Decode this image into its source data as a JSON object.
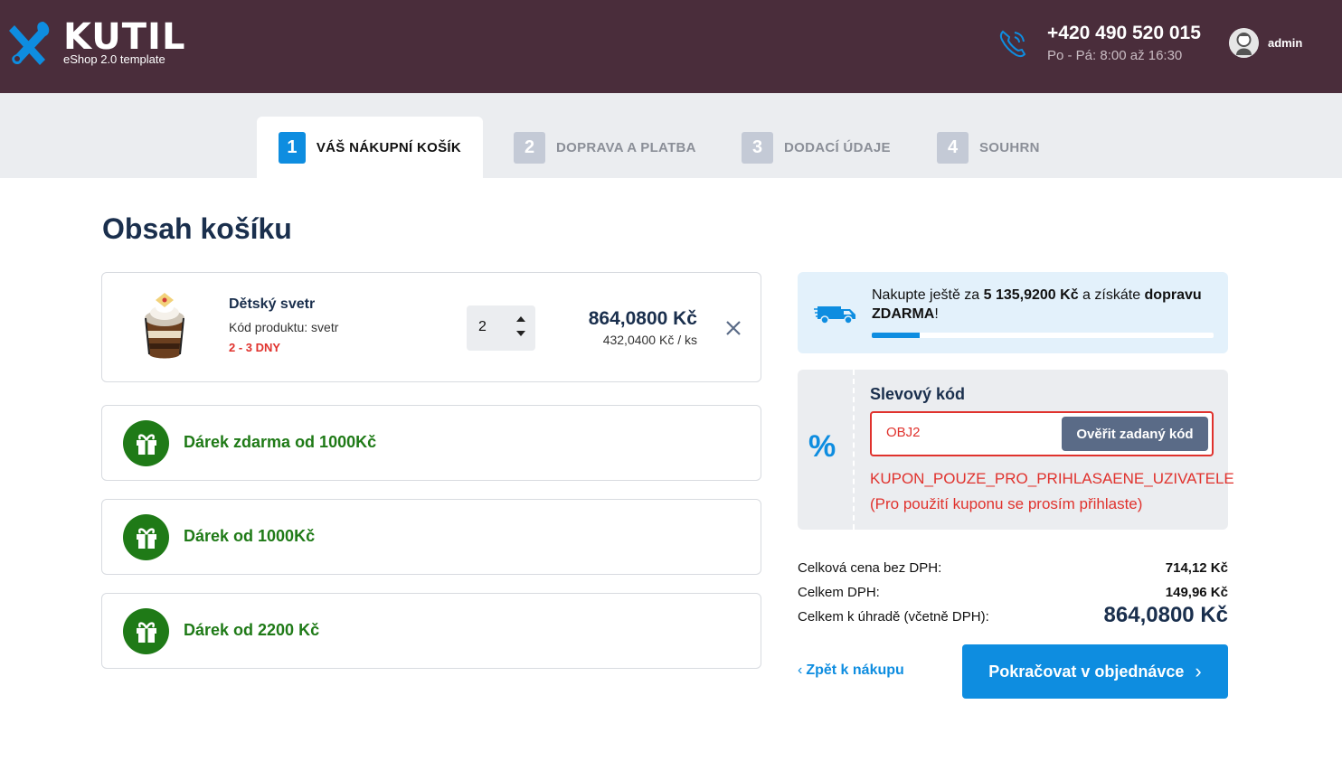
{
  "header": {
    "logo_name": "KUTIL",
    "logo_sub": "eShop 2.0 template",
    "phone": "+420 490 520 015",
    "hours": "Po - Pá: 8:00 až 16:30",
    "user": "admin"
  },
  "steps": [
    {
      "num": "1",
      "label": "VÁŠ NÁKUPNÍ KOŠÍK"
    },
    {
      "num": "2",
      "label": "DOPRAVA A PLATBA"
    },
    {
      "num": "3",
      "label": "DODACÍ ÚDAJE"
    },
    {
      "num": "4",
      "label": "SOUHRN"
    }
  ],
  "page_title": "Obsah košíku",
  "product": {
    "name": "Dětský svetr",
    "code": "Kód produktu: svetr",
    "stock": "2 - 3 DNY",
    "quantity": "2",
    "price_total": "864,0800 Kč",
    "price_unit": "432,0400 Kč / ks"
  },
  "gifts": [
    "Dárek zdarma od 1000Kč",
    "Dárek od 1000Kč",
    "Dárek od 2200 Kč"
  ],
  "shipping": {
    "text_before": "Nakupte ještě za ",
    "amount": "5 135,9200 Kč",
    "text_mid": " a získáte ",
    "free": "dopravu ZDARMA",
    "text_end": "!",
    "progress": 0.14
  },
  "coupon": {
    "title": "Slevový kód",
    "value": "OBJ2",
    "button": "Ověřit zadaný kód",
    "error_line1": "KUPON_POUZE_PRO_PRIHLASAENE_UZIVATELE",
    "error_line2": "(Pro použití kuponu se prosím přihlaste)"
  },
  "totals": {
    "net_label": "Celková cena bez DPH:",
    "net_value": "714,12 Kč",
    "vat_label": "Celkem DPH:",
    "vat_value": "149,96 Kč",
    "grand_label": "Celkem k úhradě (včetně DPH):",
    "grand_value": "864,0800 Kč"
  },
  "actions": {
    "back": "Zpět k nákupu",
    "continue": "Pokračovat v objednávce"
  },
  "colors": {
    "header_bg": "#4a2d3b",
    "accent": "#0e8de0",
    "gift_green": "#1f7a17",
    "error_red": "#e0322d"
  }
}
